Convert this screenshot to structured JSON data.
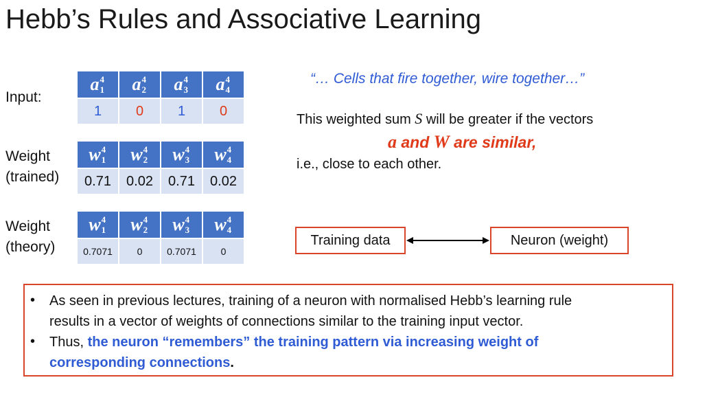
{
  "title": "Hebb’s Rules and Associative Learning",
  "rows": {
    "input": {
      "label": "Input:",
      "headers": [
        {
          "sym": "a",
          "sup": "4",
          "sub": "1"
        },
        {
          "sym": "a",
          "sup": "4",
          "sub": "2"
        },
        {
          "sym": "a",
          "sup": "4",
          "sub": "3"
        },
        {
          "sym": "a",
          "sup": "4",
          "sub": "4"
        }
      ],
      "values": [
        "1",
        "0",
        "1",
        "0"
      ]
    },
    "weight_trained": {
      "label_line1": "Weight",
      "label_line2": "(trained)",
      "headers": [
        {
          "sym": "w",
          "sup": "4",
          "sub": "1"
        },
        {
          "sym": "w",
          "sup": "4",
          "sub": "2"
        },
        {
          "sym": "w",
          "sup": "4",
          "sub": "3"
        },
        {
          "sym": "w",
          "sup": "4",
          "sub": "4"
        }
      ],
      "values": [
        "0.71",
        "0.02",
        "0.71",
        "0.02"
      ]
    },
    "weight_theory": {
      "label_line1": "Weight",
      "label_line2": "(theory)",
      "headers": [
        {
          "sym": "w",
          "sup": "4",
          "sub": "1"
        },
        {
          "sym": "w",
          "sup": "4",
          "sub": "2"
        },
        {
          "sym": "w",
          "sup": "4",
          "sub": "3"
        },
        {
          "sym": "w",
          "sup": "4",
          "sub": "4"
        }
      ],
      "values": [
        "0.7071",
        "0",
        "0.7071",
        "0"
      ]
    }
  },
  "quote": "“… Cells that fire together, wire together…”",
  "desc": {
    "line1_pre": "This weighted sum ",
    "line1_symbol": "S",
    "line1_post": " will be greater if the vectors",
    "similar_a": "a",
    "similar_and": " and ",
    "similar_w": "W",
    "similar_post": " are similar,",
    "line2": "i.e., close to each other."
  },
  "diagram": {
    "left_box": "Training data",
    "right_box": "Neuron (weight)"
  },
  "bullets": {
    "b1_line1": "As seen in previous lectures, training of a neuron with normalised Hebb’s learning rule",
    "b1_line2": "results in a vector of weights of connections similar to the training input vector.",
    "b2_prefix": "Thus, ",
    "b2_highlight_line1": "the neuron “remembers” the training pattern via increasing weight of",
    "b2_highlight_line2": "corresponding connections",
    "b2_suffix": ".",
    "marker": "•"
  },
  "colors": {
    "header_blue": "#4472c4",
    "cell_light": "#d9e2f3",
    "accent_blue": "#2f5bd4",
    "accent_red": "#e03a1a",
    "box_border": "#d9452a"
  }
}
